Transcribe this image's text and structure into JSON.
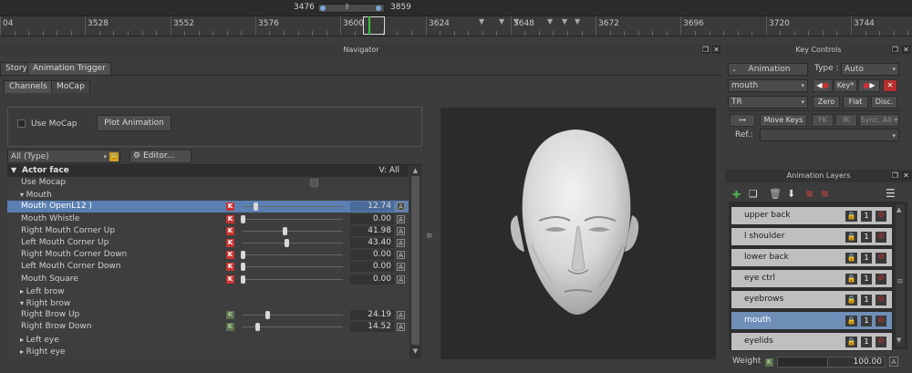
{
  "timeline": {
    "range_start": "3476",
    "range_end": "3859",
    "ticks": [
      "04",
      "3528",
      "3552",
      "3576",
      "3600",
      "3624",
      "3648",
      "3672",
      "3696",
      "3720",
      "3744"
    ]
  },
  "navigator": {
    "title": "Navigator",
    "top_tabs": [
      "Story",
      "Animation Trigger"
    ],
    "sub_tabs": [
      "Channels",
      "MoCap"
    ],
    "use_mocap_label": "Use MoCap",
    "plot_button": "Plot Animation",
    "type_filter": "All (Type)",
    "editor_button": "Editor...",
    "actor_header": "Actor face",
    "view_label": "V: All",
    "rows": [
      {
        "name": "Use Mocap",
        "indent": 1,
        "kind": "checkbox"
      },
      {
        "name": "Mouth",
        "indent": 1,
        "kind": "group",
        "expanded": true
      },
      {
        "name": "Mouth OpenL12 )",
        "indent": 1,
        "kind": "slider",
        "value": "12.74",
        "num": 12.74,
        "key": "red",
        "selected": true
      },
      {
        "name": "Mouth Whistle",
        "indent": 1,
        "kind": "slider",
        "value": "0.00",
        "num": 0,
        "key": "red"
      },
      {
        "name": "Right Mouth Corner Up",
        "indent": 1,
        "kind": "slider",
        "value": "41.98",
        "num": 41.98,
        "key": "red"
      },
      {
        "name": "Left Mouth Corner Up",
        "indent": 1,
        "kind": "slider",
        "value": "43.40",
        "num": 43.4,
        "key": "red"
      },
      {
        "name": "Right Mouth Corner Down",
        "indent": 1,
        "kind": "slider",
        "value": "0.00",
        "num": 0,
        "key": "red"
      },
      {
        "name": "Left Mouth Corner Down",
        "indent": 1,
        "kind": "slider",
        "value": "0.00",
        "num": 0,
        "key": "red"
      },
      {
        "name": "Mouth Square",
        "indent": 1,
        "kind": "slider",
        "value": "0.00",
        "num": 0,
        "key": "red"
      },
      {
        "name": "Left brow",
        "indent": 1,
        "kind": "group",
        "expanded": false
      },
      {
        "name": "Right brow",
        "indent": 1,
        "kind": "group",
        "expanded": true
      },
      {
        "name": "Right Brow Up",
        "indent": 1,
        "kind": "slider",
        "value": "24.19",
        "num": 24.19,
        "key": "green"
      },
      {
        "name": "Right Brow Down",
        "indent": 1,
        "kind": "slider",
        "value": "14.52",
        "num": 14.52,
        "key": "green"
      },
      {
        "name": "Left eye",
        "indent": 1,
        "kind": "group",
        "expanded": false
      },
      {
        "name": "Right eye",
        "indent": 1,
        "kind": "group",
        "expanded": false
      }
    ]
  },
  "key_controls": {
    "title": "Key Controls",
    "mode": "Animation",
    "type_label": "Type :",
    "type_value": "Auto",
    "layer_select": "mouth",
    "key_label": "Key*",
    "channel_select": "TR",
    "zero": "Zero",
    "flat": "Flat",
    "disc": "Disc.",
    "move_keys": "Move Keys",
    "fk": "FK",
    "ik": "IK",
    "sync": "Sync. All",
    "ref_label": "Ref.:"
  },
  "anim_layers": {
    "title": "Animation Layers",
    "layers": [
      "upper back",
      "l shoulder",
      "lower back",
      "eye ctrl",
      "eyebrows",
      "mouth",
      "eyelids"
    ],
    "selected": "mouth",
    "weight_label": "Weight",
    "weight_value": "100.00"
  },
  "colors": {
    "selection": "#5a7fb2",
    "key_red": "#c83434",
    "playhead": "#38c038"
  }
}
